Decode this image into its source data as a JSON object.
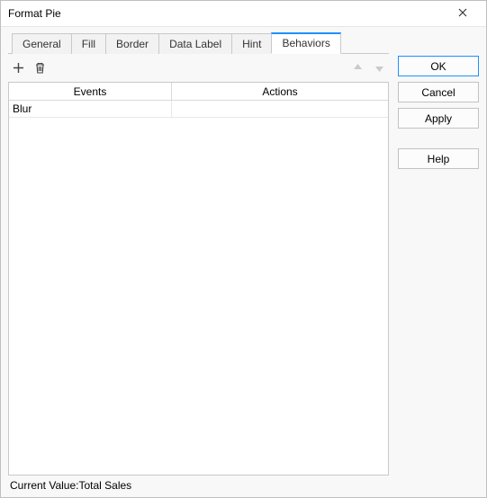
{
  "window": {
    "title": "Format Pie"
  },
  "tabs": {
    "general": "General",
    "fill": "Fill",
    "border": "Border",
    "data_label": "Data Label",
    "hint": "Hint",
    "behaviors": "Behaviors",
    "active": "behaviors"
  },
  "grid": {
    "headers": {
      "events": "Events",
      "actions": "Actions"
    },
    "rows": [
      {
        "event": "Blur",
        "action": ""
      }
    ]
  },
  "status": {
    "label": "Current Value:",
    "value": "Total Sales"
  },
  "buttons": {
    "ok": "OK",
    "cancel": "Cancel",
    "apply": "Apply",
    "help": "Help"
  }
}
